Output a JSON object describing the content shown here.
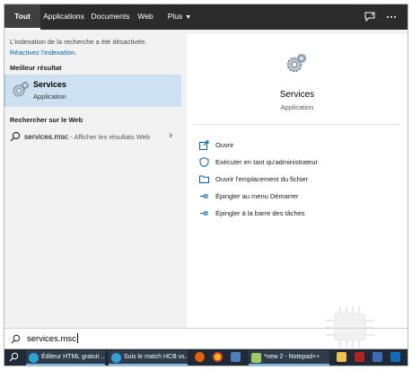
{
  "tabs": [
    {
      "label": "Tout"
    },
    {
      "label": "Applications"
    },
    {
      "label": "Documents"
    },
    {
      "label": "Web"
    },
    {
      "label": "Plus"
    }
  ],
  "notice": {
    "text": "L'indexation de la recherche a été désactivée.",
    "link": "Réactivez l'indexation."
  },
  "best_match": {
    "heading": "Meilleur résultat",
    "title": "Services",
    "subtitle": "Application"
  },
  "web_search": {
    "heading": "Rechercher sur le Web",
    "query": "services.msc",
    "hint": " - Afficher les résultats Web"
  },
  "preview": {
    "title": "Services",
    "subtitle": "Application",
    "actions": [
      {
        "label": "Ouvrir",
        "icon": "open-icon"
      },
      {
        "label": "Exécuter en tant qu'administrateur",
        "icon": "shield-icon"
      },
      {
        "label": "Ouvrir l'emplacement du fichier",
        "icon": "folder-icon"
      },
      {
        "label": "Épingler au menu Démarrer",
        "icon": "pin-icon"
      },
      {
        "label": "Épingler à la barre des tâches",
        "icon": "pin-icon"
      }
    ]
  },
  "search_box": {
    "value": "services.msc"
  },
  "taskbar": {
    "items": [
      {
        "label": "Éditeur HTML gratuit ...",
        "icon": "edge-icon"
      },
      {
        "label": "Suis le match HCB vs....",
        "icon": "edge-icon"
      },
      {
        "label": "*new 2 - Notepad++",
        "icon": "notepad-icon"
      }
    ]
  },
  "colors": {
    "accent": "#0063b1",
    "selected_bg": "#cde1f2",
    "topbar": "#2b2b2b",
    "taskbar": "#1f2a36"
  }
}
